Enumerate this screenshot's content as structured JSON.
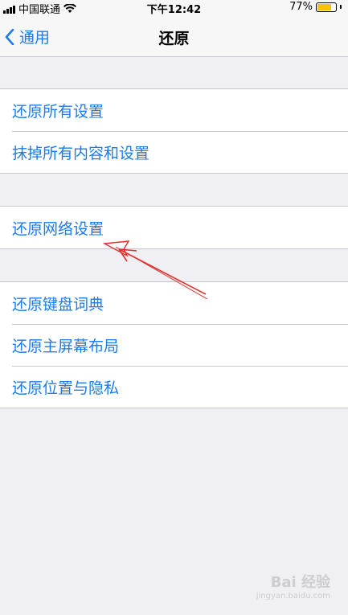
{
  "status_bar": {
    "carrier": "中国联通",
    "time": "下午12:42",
    "battery_percent": "77%",
    "battery_level": 0.77,
    "battery_color": "#f5c400"
  },
  "nav": {
    "back_label": "通用",
    "title": "还原"
  },
  "groups": [
    {
      "items": [
        "还原所有设置",
        "抹掉所有内容和设置"
      ]
    },
    {
      "items": [
        "还原网络设置"
      ]
    },
    {
      "items": [
        "还原键盘词典",
        "还原主屏幕布局",
        "还原位置与隐私"
      ]
    }
  ],
  "accent_color": "#1a7bf2",
  "annotation_color": "#e0302c",
  "watermark": {
    "brand": "Bai 经验",
    "url": "jingyan.baidu.com"
  }
}
